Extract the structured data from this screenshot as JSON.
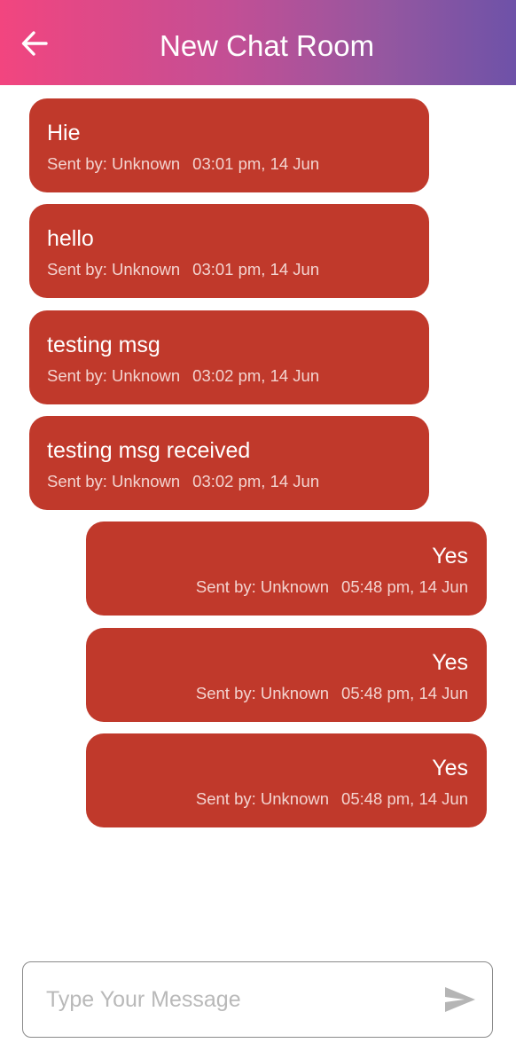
{
  "header": {
    "title": "New Chat Room",
    "back_icon": "arrow-left-icon"
  },
  "messages": [
    {
      "text": "Hie",
      "sender": "Sent by: Unknown",
      "time": "03:01 pm, 14 Jun",
      "align": "left"
    },
    {
      "text": "hello",
      "sender": "Sent by: Unknown",
      "time": "03:01 pm, 14 Jun",
      "align": "left"
    },
    {
      "text": "testing msg",
      "sender": "Sent by: Unknown",
      "time": "03:02 pm, 14 Jun",
      "align": "left"
    },
    {
      "text": "testing msg received",
      "sender": "Sent by: Unknown",
      "time": "03:02 pm, 14 Jun",
      "align": "left"
    },
    {
      "text": "Yes",
      "sender": "Sent by: Unknown",
      "time": "05:48 pm, 14 Jun",
      "align": "right"
    },
    {
      "text": "Yes",
      "sender": "Sent by: Unknown",
      "time": "05:48 pm, 14 Jun",
      "align": "right"
    },
    {
      "text": "Yes",
      "sender": "Sent by: Unknown",
      "time": "05:48 pm, 14 Jun",
      "align": "right"
    }
  ],
  "composer": {
    "value": "",
    "placeholder": "Type Your Message",
    "send_icon": "send-icon"
  },
  "colors": {
    "header_gradient_start": "#f2457f",
    "header_gradient_end": "#6e52a8",
    "bubble": "#c0392b",
    "bubble_text": "#ffffff",
    "meta_text": "#f3d4d0",
    "placeholder": "#b9b9b9"
  }
}
